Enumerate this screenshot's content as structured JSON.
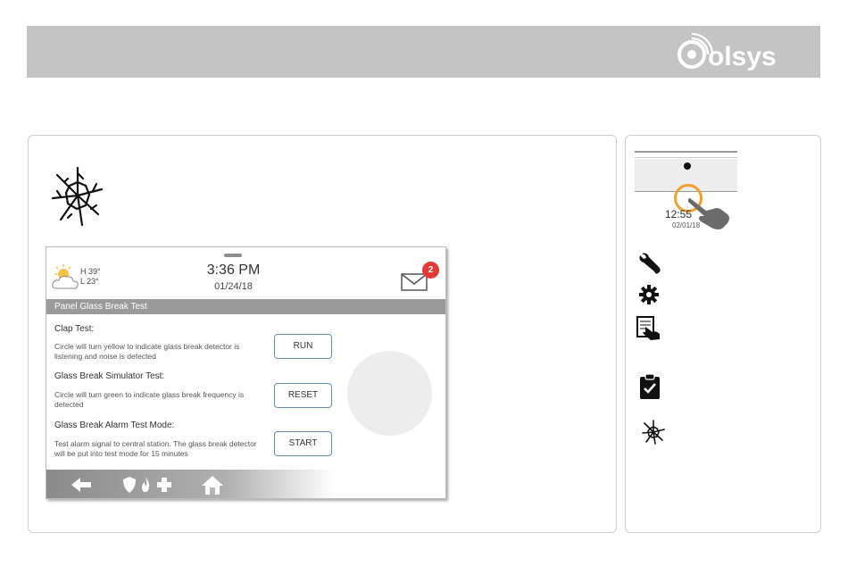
{
  "brand": {
    "logo_text": "olsys"
  },
  "screen": {
    "weather": {
      "high": "H 39°",
      "low": "L 23°"
    },
    "time": "3:36 PM",
    "date": "01/24/18",
    "mail_badge": "2",
    "title": "Panel Glass Break Test",
    "tests": [
      {
        "title": "Clap Test:",
        "description": "Circle will turn yellow to indicate glass break detector is listening and noise is detected",
        "button": "RUN"
      },
      {
        "title": "Glass Break Simulator Test:",
        "description": "Circle will turn green to indicate glass break frequency is detected",
        "button": "RESET"
      },
      {
        "title": "Glass Break Alarm Test Mode:",
        "description": "Test alarm signal to central station. The glass break detector will be put into test mode for 15 minutes",
        "button": "START"
      }
    ],
    "nav_icons": [
      "back-arrow-icon",
      "shield-icon",
      "fire-icon",
      "medical-cross-icon",
      "home-icon"
    ]
  },
  "sidebar_steps": {
    "mini_time": "12:55",
    "mini_date": "02/01/18",
    "icons": [
      "wrench-icon",
      "gear-icon",
      "touch-panel-icon",
      "clipboard-check-icon",
      "glass-break-icon"
    ]
  },
  "colors": {
    "banner": "#c4c4c4",
    "title_bar": "#9a9a9a",
    "badge": "#e53935",
    "button_border": "#6a8db5",
    "highlight_ring": "#f0a030"
  }
}
